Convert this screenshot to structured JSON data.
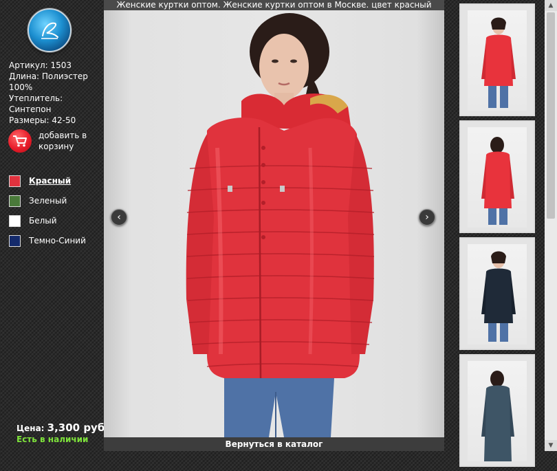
{
  "title": "Женские куртки оптом. Женские куртки оптом в Москве. цвет красный",
  "product": {
    "article": "Артикул: 1503",
    "length": "Длина: Полиэстер 100%",
    "insulation": "Утеплитель: Синтепон",
    "sizes": "Размеры: 42-50"
  },
  "cart": {
    "label": "добавить в корзину",
    "icon": "shopping-cart-icon"
  },
  "colors": [
    {
      "name": "Красный",
      "hex": "#e0323e",
      "active": true
    },
    {
      "name": "Зеленый",
      "hex": "#4a7a3a",
      "active": false
    },
    {
      "name": "Белый",
      "hex": "#ffffff",
      "active": false
    },
    {
      "name": "Темно-Синий",
      "hex": "#142a6b",
      "active": false
    }
  ],
  "price": {
    "label": "Цена:",
    "value": "3,300 руб."
  },
  "stock": "Есть в наличии",
  "back_link": "Вернуться в каталог",
  "nav": {
    "prev_icon": "chevron-left-icon",
    "next_icon": "chevron-right-icon"
  },
  "thumbnails": [
    {
      "color": "#e8333c",
      "view": "front"
    },
    {
      "color": "#e8333c",
      "view": "back"
    },
    {
      "color": "#1f2a38",
      "view": "front"
    },
    {
      "color": "#3e5566",
      "view": "back"
    }
  ]
}
